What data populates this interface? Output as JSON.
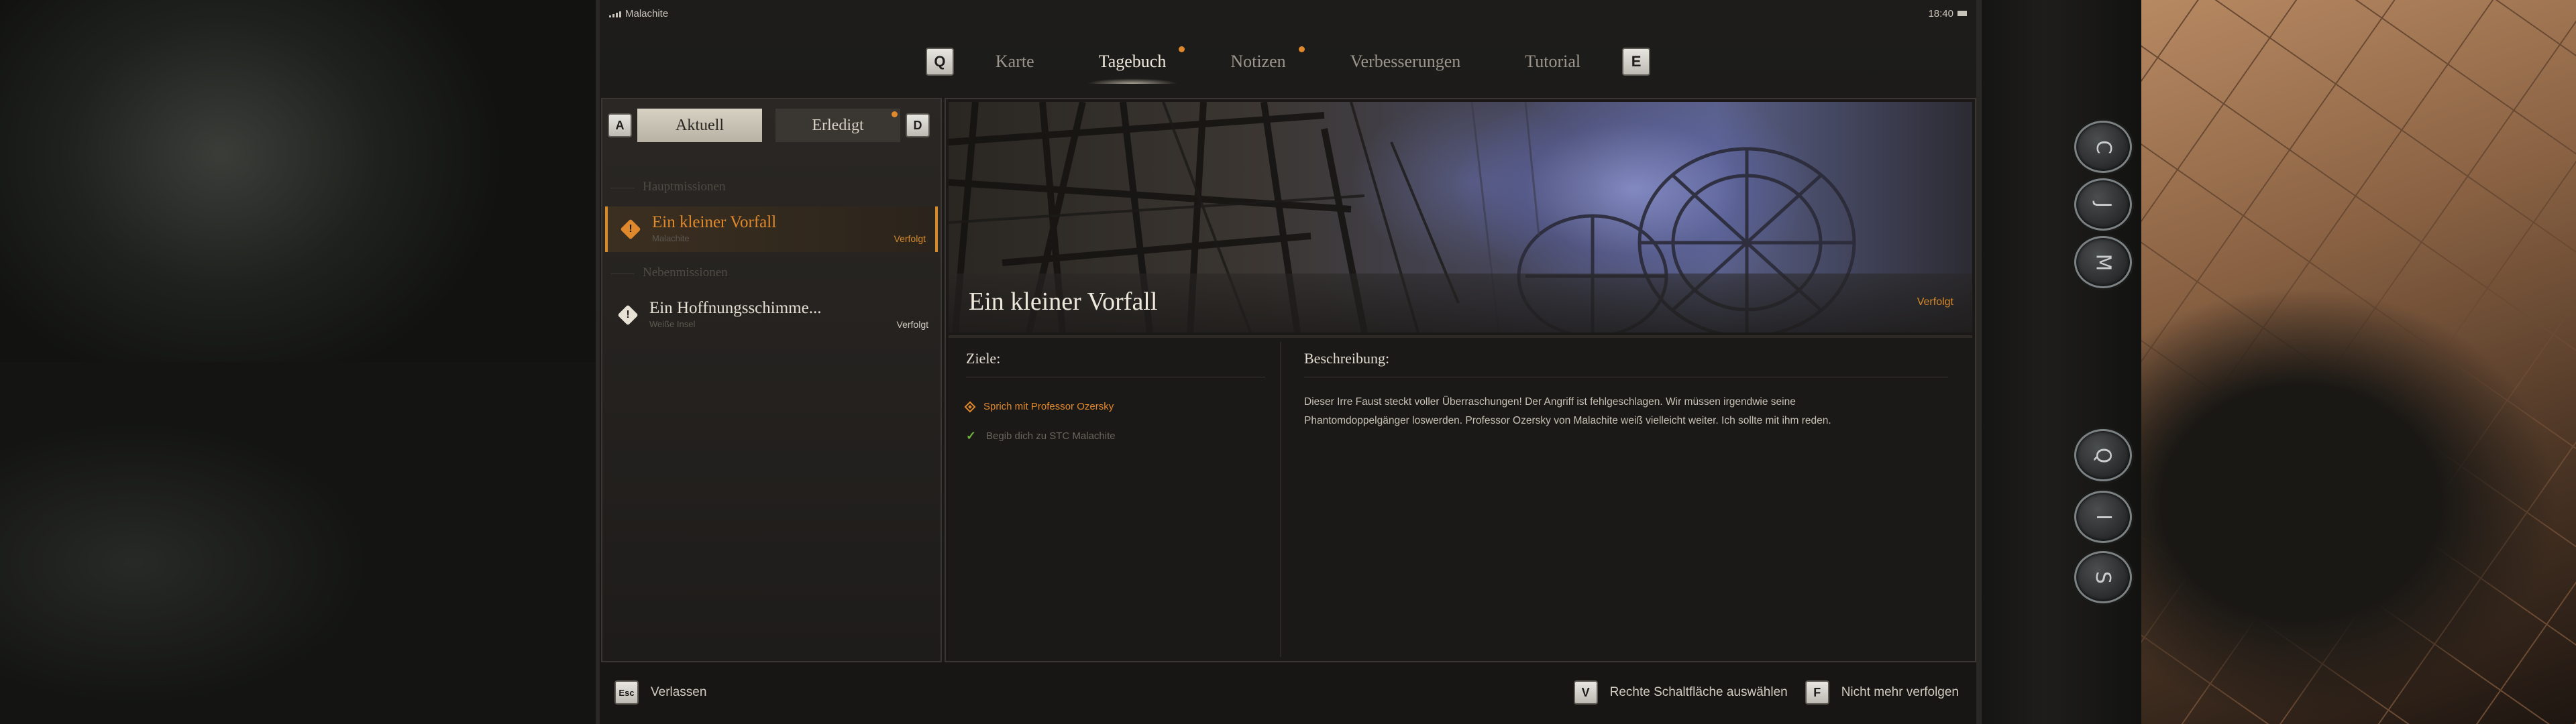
{
  "status": {
    "carrier": "Malachite",
    "time": "18:40"
  },
  "tabs": {
    "key_left": "Q",
    "key_right": "E",
    "items": [
      {
        "label": "Karte",
        "active": false,
        "dot": false
      },
      {
        "label": "Tagebuch",
        "active": true,
        "dot": true
      },
      {
        "label": "Notizen",
        "active": false,
        "dot": true
      },
      {
        "label": "Verbesserungen",
        "active": false,
        "dot": false
      },
      {
        "label": "Tutorial",
        "active": false,
        "dot": false
      }
    ]
  },
  "filters": {
    "key_left": "A",
    "key_right": "D",
    "current": "Aktuell",
    "done": "Erledigt"
  },
  "list": {
    "main_header": "Hauptmissionen",
    "side_header": "Nebenmissionen",
    "main_quest": {
      "title": "Ein kleiner Vorfall",
      "location": "Malachite",
      "status": "Verfolgt"
    },
    "side_quest": {
      "title": "Ein Hoffnungsschimme...",
      "location": "Weiße Insel",
      "status": "Verfolgt"
    }
  },
  "detail": {
    "title": "Ein kleiner Vorfall",
    "status": "Verfolgt",
    "objectives_header": "Ziele:",
    "description_header": "Beschreibung:",
    "objectives": [
      {
        "text": "Sprich mit Professor Ozersky",
        "state": "active"
      },
      {
        "text": "Begib dich zu STC Malachite",
        "state": "done"
      }
    ],
    "description": "Dieser Irre Faust steckt voller Überraschungen! Der Angriff ist fehlgeschlagen. Wir müssen irgendwie seine Phantomdoppelgänger loswerden. Professor Ozersky von Malachite weiß vielleicht weiter. Ich sollte mit ihm reden."
  },
  "bottom": {
    "esc_key": "Esc",
    "leave": "Verlassen",
    "v_key": "V",
    "select_right": "Rechte Schaltfläche auswählen",
    "f_key": "F",
    "untrack": "Nicht mehr verfolgen"
  },
  "side_buttons": [
    "C",
    "J",
    "M",
    "Q",
    "I",
    "S"
  ],
  "colors": {
    "accent": "#e0882c",
    "done": "#6fb23c",
    "text": "#cfc8bd"
  },
  "icons": {
    "quest_marker": "exclamation-diamond-icon",
    "objective_active": "diamond-icon",
    "objective_done": "checkmark-icon"
  }
}
